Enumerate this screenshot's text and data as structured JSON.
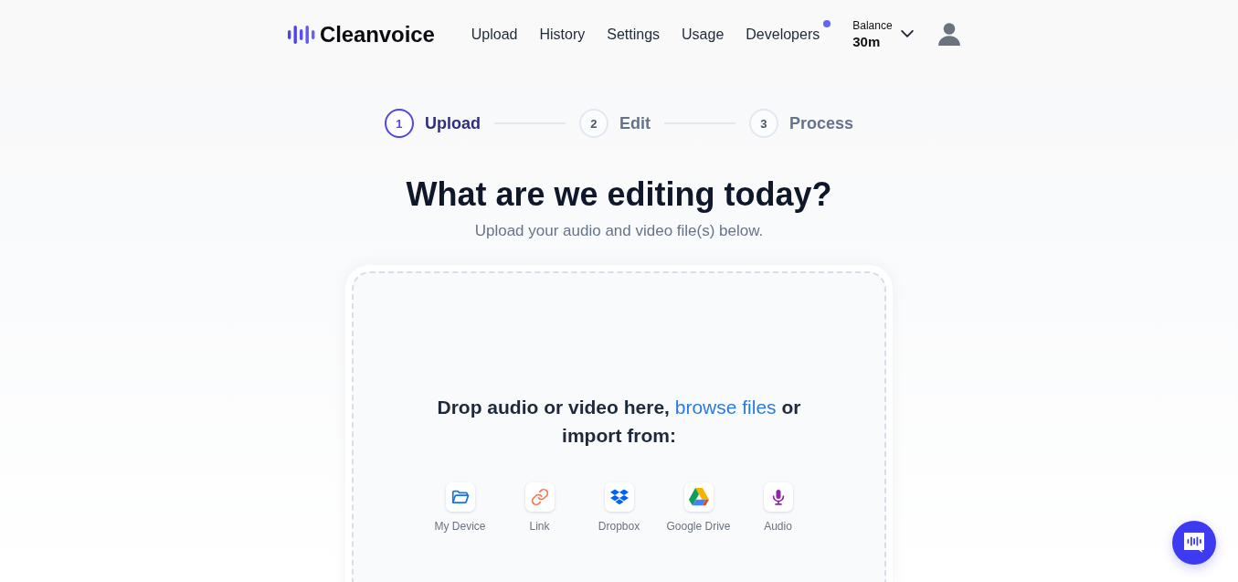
{
  "header": {
    "logo": "Cleanvoice",
    "nav": [
      {
        "label": "Upload",
        "notification": false
      },
      {
        "label": "History",
        "notification": false
      },
      {
        "label": "Settings",
        "notification": false
      },
      {
        "label": "Usage",
        "notification": false
      },
      {
        "label": "Developers",
        "notification": true
      }
    ],
    "balance": {
      "label": "Balance",
      "value": "30m"
    }
  },
  "steps": [
    {
      "number": "1",
      "label": "Upload",
      "selected": true
    },
    {
      "number": "2",
      "label": "Edit",
      "selected": false
    },
    {
      "number": "3",
      "label": "Process",
      "selected": false
    }
  ],
  "title": "What are we editing today?",
  "subtitle": "Upload your audio and video file(s) below.",
  "dropzone": {
    "text": "Drop audio or video here,",
    "link": "browse files",
    "text_end": "or import from:",
    "sources": [
      {
        "kind": "device",
        "label": "My Device"
      },
      {
        "kind": "link",
        "label": "Link"
      },
      {
        "kind": "dropbox",
        "label": "Dropbox"
      },
      {
        "kind": "google-drive",
        "label": "Google Drive"
      },
      {
        "kind": "audio",
        "label": "Audio"
      }
    ]
  }
}
